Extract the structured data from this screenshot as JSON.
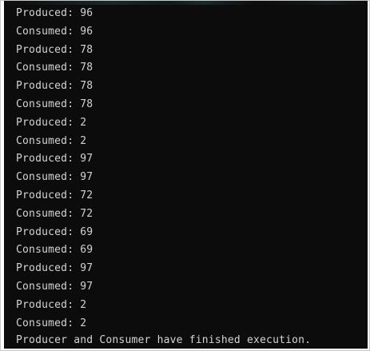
{
  "terminal": {
    "lines": [
      "Produced: 96",
      "Consumed: 96",
      "Produced: 78",
      "Consumed: 78",
      "Produced: 78",
      "Consumed: 78",
      "Produced: 2",
      "Consumed: 2",
      "Produced: 97",
      "Consumed: 97",
      "Produced: 72",
      "Consumed: 72",
      "Produced: 69",
      "Consumed: 69",
      "Produced: 97",
      "Consumed: 97",
      "Produced: 2",
      "Consumed: 2"
    ],
    "final_message": "Producer and Consumer have finished execution.",
    "colors": {
      "background": "#0c0c0c",
      "text": "#d4d4d4"
    }
  }
}
